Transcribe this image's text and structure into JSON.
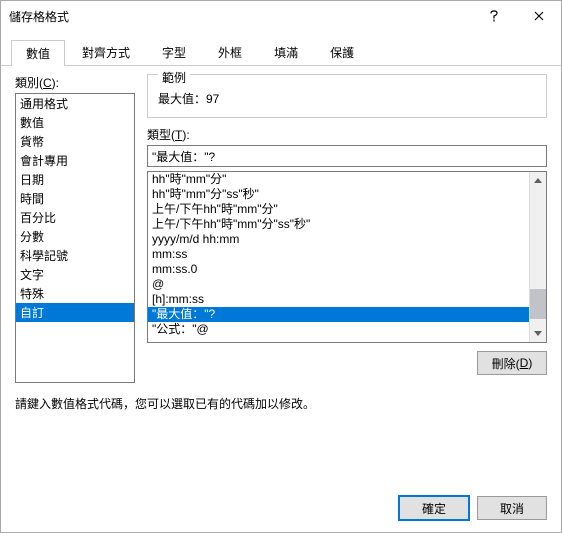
{
  "window": {
    "title": "儲存格格式",
    "help_aria": "說明",
    "close_aria": "關閉"
  },
  "tabs": {
    "items": [
      {
        "label": "數值"
      },
      {
        "label": "對齊方式"
      },
      {
        "label": "字型"
      },
      {
        "label": "外框"
      },
      {
        "label": "填滿"
      },
      {
        "label": "保護"
      }
    ],
    "active_index": 0
  },
  "category": {
    "label_prefix": "類別(",
    "label_key": "C",
    "label_suffix": "):",
    "items": [
      "通用格式",
      "數值",
      "貨幣",
      "會計專用",
      "日期",
      "時間",
      "百分比",
      "分數",
      "科學記號",
      "文字",
      "特殊",
      "自訂"
    ],
    "selected_index": 11
  },
  "sample": {
    "legend": "範例",
    "value": "最大值：97"
  },
  "type": {
    "label_prefix": "類型(",
    "label_key": "T",
    "label_suffix": "):",
    "input_value": "\"最大值：\"?",
    "items": [
      "hh\"時\"mm\"分\"",
      "hh\"時\"mm\"分\"ss\"秒\"",
      "上午/下午hh\"時\"mm\"分\"",
      "上午/下午hh\"時\"mm\"分\"ss\"秒\"",
      "yyyy/m/d hh:mm",
      "mm:ss",
      "mm:ss.0",
      "@",
      "[h]:mm:ss",
      "\"最大值：\"?",
      "\"公式：\"@"
    ],
    "selected_index": 9
  },
  "delete_btn": {
    "label_prefix": "刪除(",
    "label_key": "D",
    "label_suffix": ")"
  },
  "hint": "請鍵入數值格式代碼，您可以選取已有的代碼加以修改。",
  "footer": {
    "ok": "確定",
    "cancel": "取消"
  }
}
